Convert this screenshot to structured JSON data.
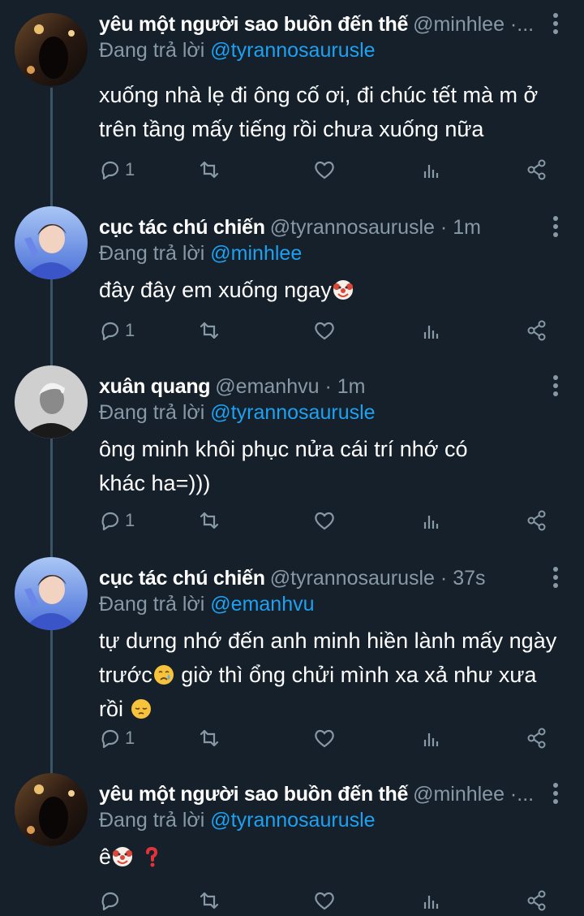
{
  "theme": {
    "background": "#15202b",
    "accent": "#1da1f2",
    "muted": "#8899a6",
    "thread_line": "#3d5466"
  },
  "reply_prefix": "Đang trả lời",
  "tweets": [
    {
      "name": "yêu một người sao buồn đến thế",
      "handle": "@minhlee ·...",
      "time": "",
      "reply_to": "@tyrannosaurusle",
      "text": "xuống nhà lẹ đi ông cố ơi, đi chúc tết mà m ở trên tầng mấy tiếng rồi chưa xuống nữa",
      "emoji": [],
      "reply_count": "1",
      "avatar": "dark-photo"
    },
    {
      "name": "cục tác chú chiến",
      "handle": "@tyrannosaurusle",
      "time": "1m",
      "reply_to": "@minhlee",
      "text": "đây đây em xuống ngay",
      "emoji": [
        "clown-face-emoji"
      ],
      "reply_count": "1",
      "avatar": "blue-portrait"
    },
    {
      "name": "xuân quang",
      "handle": "@emanhvu",
      "time": "1m",
      "reply_to": "@tyrannosaurusle",
      "text": "ông minh khôi phục nửa cái trí nhớ có khác ha=)))",
      "emoji": [],
      "reply_count": "1",
      "avatar": "bw-portrait"
    },
    {
      "name": "cục tác chú chiến",
      "handle": "@tyrannosaurusle",
      "time": "37s",
      "reply_to": "@emanhvu",
      "text_a": "tự dưng nhớ đến anh minh hiền lành mấy ngày trước",
      "text_b": " giờ thì ổng chửi mình xa xả như xưa rồi ",
      "emoji": [
        "crying-face-emoji",
        "pensive-face-emoji"
      ],
      "reply_count": "1",
      "avatar": "blue-portrait"
    },
    {
      "name": "yêu một người sao buồn đến thế",
      "handle": "@minhlee ·...",
      "time": "",
      "reply_to": "@tyrannosaurusle",
      "text": "ê",
      "emoji": [
        "clown-face-emoji",
        "red-question-mark-emoji"
      ],
      "reply_count": "",
      "avatar": "dark-photo"
    }
  ]
}
